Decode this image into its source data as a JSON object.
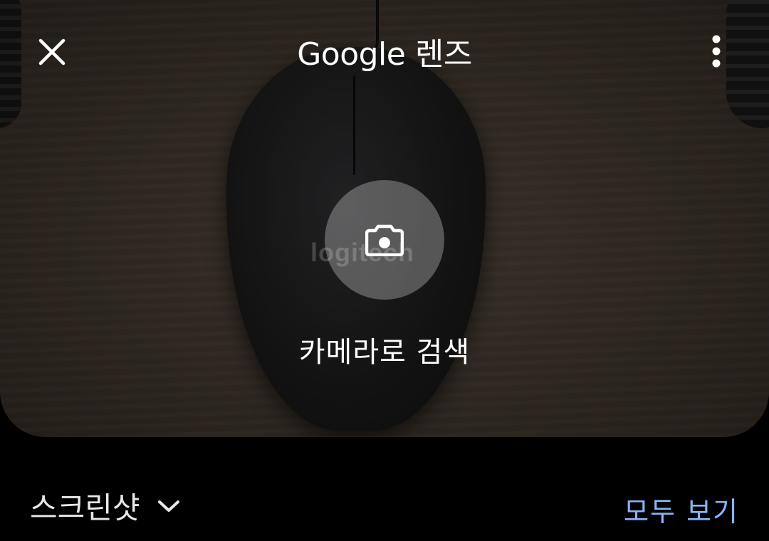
{
  "header": {
    "title": "Google 렌즈",
    "close_icon": "close-icon",
    "more_icon": "more-vert-icon"
  },
  "viewfinder": {
    "camera_icon": "camera-icon",
    "camera_label": "카메라로 검색"
  },
  "bottom": {
    "screenshots_label": "스크린샷",
    "dropdown_icon": "chevron-down-icon",
    "view_all_label": "모두 보기"
  },
  "colors": {
    "accent": "#8ab4f8",
    "background": "#000000",
    "text": "#ffffff"
  }
}
